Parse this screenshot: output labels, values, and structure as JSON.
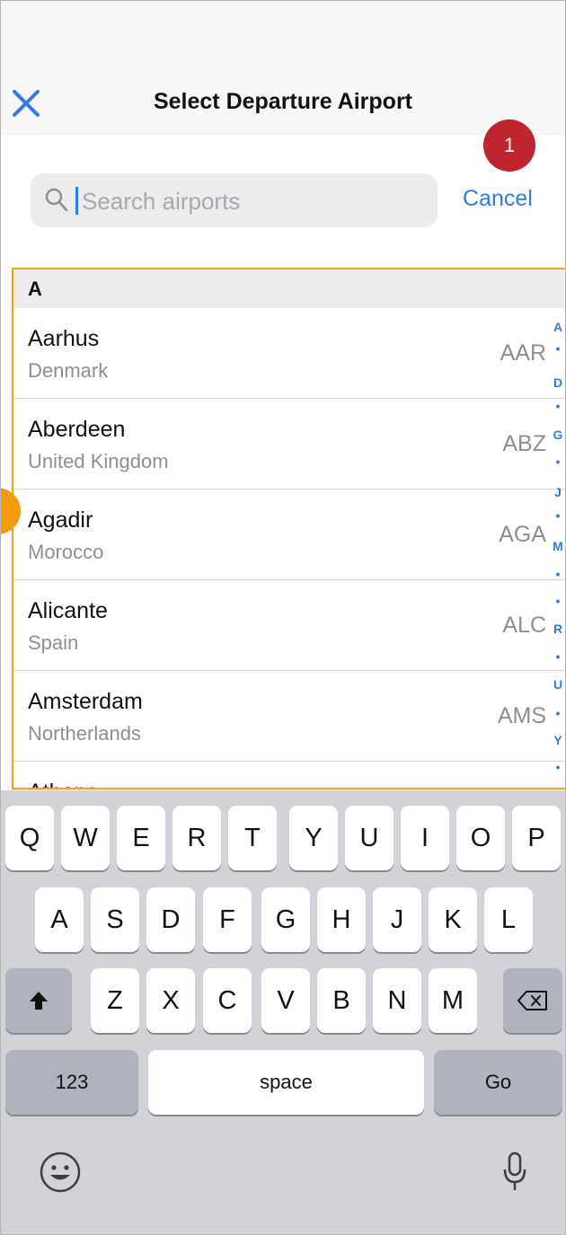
{
  "header": {
    "title": "Select Departure Airport",
    "close_icon": "close-icon"
  },
  "search": {
    "placeholder": "Search airports",
    "value": "",
    "cancel_label": "Cancel"
  },
  "annotations": {
    "badge_1": "1"
  },
  "list": {
    "section_label": "A",
    "airports": [
      {
        "city": "Aarhus",
        "country": "Denmark",
        "code": "AAR"
      },
      {
        "city": "Aberdeen",
        "country": "United Kingdom",
        "code": "ABZ"
      },
      {
        "city": "Agadir",
        "country": "Morocco",
        "code": "AGA"
      },
      {
        "city": "Alicante",
        "country": "Spain",
        "code": "ALC"
      },
      {
        "city": "Amsterdam",
        "country": "Northerlands",
        "code": "AMS"
      },
      {
        "city": "Athens",
        "country": "",
        "code": ""
      }
    ]
  },
  "index_bar": [
    "A",
    "•",
    "D",
    "•",
    "G",
    "•",
    "J",
    "•",
    "M",
    "•",
    "•",
    "R",
    "•",
    "U",
    "•",
    "Y",
    "•"
  ],
  "keyboard": {
    "row1": [
      "Q",
      "W",
      "E",
      "R",
      "T",
      "Y",
      "U",
      "I",
      "O",
      "P"
    ],
    "row2": [
      "A",
      "S",
      "D",
      "F",
      "G",
      "H",
      "J",
      "K",
      "L"
    ],
    "row3": [
      "Z",
      "X",
      "C",
      "V",
      "B",
      "N",
      "M"
    ],
    "numbers_label": "123",
    "space_label": "space",
    "go_label": "Go"
  },
  "colors": {
    "accent": "#2f7be8",
    "highlight": "#f4a21b",
    "badge": "#c0242c"
  }
}
